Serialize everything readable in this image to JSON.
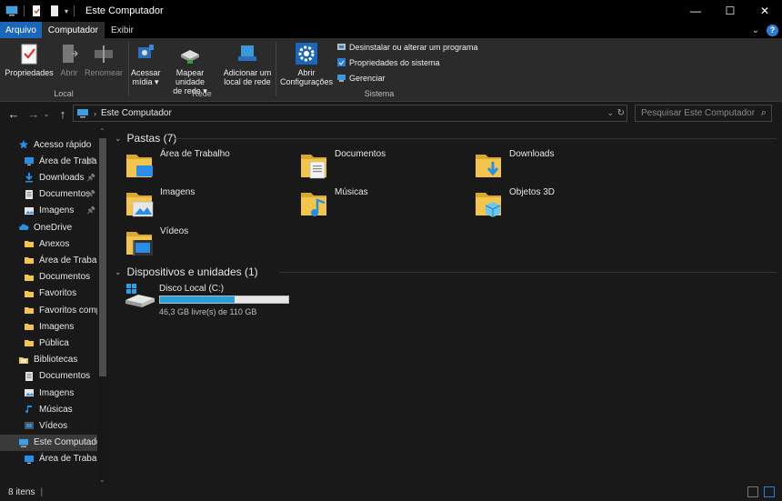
{
  "window": {
    "title": "Este Computador",
    "controls": {
      "minimize": "—",
      "maximize": "☐",
      "close": "✕"
    }
  },
  "ribbon_tabs": [
    {
      "label": "Arquivo",
      "kind": "file"
    },
    {
      "label": "Computador",
      "kind": "active"
    },
    {
      "label": "Exibir",
      "kind": "normal"
    }
  ],
  "ribbon": {
    "local": {
      "label": "Local",
      "buttons": [
        {
          "label": "Propriedades",
          "disabled": false
        },
        {
          "label": "Abrir",
          "disabled": true
        },
        {
          "label": "Renomear",
          "disabled": true
        }
      ]
    },
    "rede": {
      "label": "Rede",
      "buttons": [
        {
          "label": "Acessar\nmídia ▾"
        },
        {
          "label": "Mapear unidade\nde rede ▾"
        },
        {
          "label": "Adicionar um\nlocal de rede"
        }
      ]
    },
    "sistema": {
      "label": "Sistema",
      "open_settings": "Abrir\nConfigurações",
      "small": [
        "Desinstalar ou alterar um programa",
        "Propriedades do sistema",
        "Gerenciar"
      ]
    }
  },
  "address": {
    "path": "Este Computador",
    "search_placeholder": "Pesquisar Este Computador"
  },
  "nav": [
    {
      "label": "Acesso rápido",
      "icon": "star-icon",
      "indent": 0,
      "pinned": false
    },
    {
      "label": "Área de Trabalho",
      "icon": "desktop-icon",
      "indent": 1,
      "pinned": true
    },
    {
      "label": "Downloads",
      "icon": "download-icon",
      "indent": 1,
      "pinned": true
    },
    {
      "label": "Documentos",
      "icon": "document-icon",
      "indent": 1,
      "pinned": true
    },
    {
      "label": "Imagens",
      "icon": "pictures-icon",
      "indent": 1,
      "pinned": true
    },
    {
      "label": "OneDrive",
      "icon": "cloud-icon",
      "indent": 0,
      "pinned": false
    },
    {
      "label": "Anexos",
      "icon": "folder-icon",
      "indent": 1,
      "pinned": false
    },
    {
      "label": "Área de Trabalho",
      "icon": "folder-icon",
      "indent": 1,
      "pinned": false
    },
    {
      "label": "Documentos",
      "icon": "folder-icon",
      "indent": 1,
      "pinned": false
    },
    {
      "label": "Favoritos",
      "icon": "folder-icon",
      "indent": 1,
      "pinned": false
    },
    {
      "label": "Favoritos compartilhados",
      "icon": "folder-icon",
      "indent": 1,
      "pinned": false
    },
    {
      "label": "Imagens",
      "icon": "folder-icon",
      "indent": 1,
      "pinned": false
    },
    {
      "label": "Pública",
      "icon": "folder-icon",
      "indent": 1,
      "pinned": false
    },
    {
      "label": "Bibliotecas",
      "icon": "library-icon",
      "indent": 0,
      "pinned": false
    },
    {
      "label": "Documentos",
      "icon": "document-icon",
      "indent": 1,
      "pinned": false
    },
    {
      "label": "Imagens",
      "icon": "pictures-icon",
      "indent": 1,
      "pinned": false
    },
    {
      "label": "Músicas",
      "icon": "music-icon",
      "indent": 1,
      "pinned": false
    },
    {
      "label": "Vídeos",
      "icon": "video-icon",
      "indent": 1,
      "pinned": false
    },
    {
      "label": "Este Computador",
      "icon": "computer-icon",
      "indent": 0,
      "pinned": false,
      "selected": true
    },
    {
      "label": "Área de Trabalho",
      "icon": "desktop-icon",
      "indent": 1,
      "pinned": false
    }
  ],
  "folders_group": {
    "title": "Pastas (7)",
    "items": [
      {
        "label": "Área de Trabalho",
        "icon": "desktop-folder-icon"
      },
      {
        "label": "Documentos",
        "icon": "documents-folder-icon"
      },
      {
        "label": "Downloads",
        "icon": "downloads-folder-icon"
      },
      {
        "label": "Imagens",
        "icon": "pictures-folder-icon"
      },
      {
        "label": "Músicas",
        "icon": "music-folder-icon"
      },
      {
        "label": "Objetos 3D",
        "icon": "3d-objects-folder-icon"
      },
      {
        "label": "Vídeos",
        "icon": "videos-folder-icon"
      }
    ]
  },
  "devices_group": {
    "title": "Dispositivos e unidades (1)",
    "drive": {
      "name": "Disco Local (C:)",
      "free_text": "46,3 GB livre(s) de 110 GB",
      "used_fraction": 0.58
    }
  },
  "status": {
    "count": "8 itens"
  },
  "colors": {
    "accent": "#1a66b8",
    "folder": "#f3c64b",
    "drive_fill": "#26a0da"
  }
}
